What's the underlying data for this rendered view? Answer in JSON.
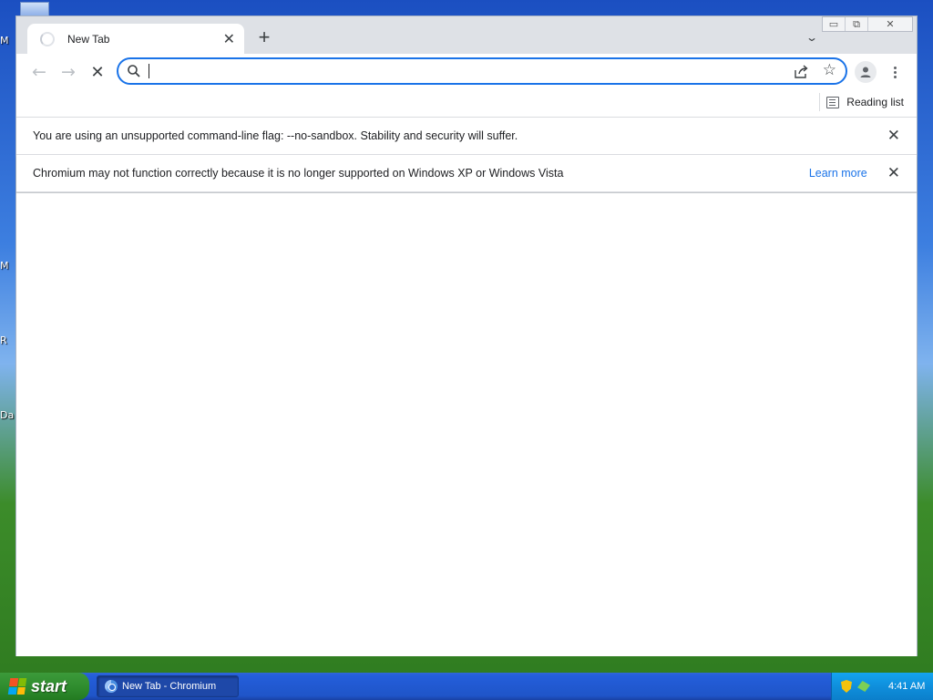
{
  "desktop": {
    "labels": [
      "M",
      "M",
      "R",
      "Da"
    ]
  },
  "window": {
    "controls": {
      "minimize": "▭",
      "restore": "⧉",
      "close": "✕"
    }
  },
  "tabs": [
    {
      "title": "New Tab",
      "close": "✕"
    }
  ],
  "tabstrip": {
    "new_tab": "+",
    "tab_search": "⌄"
  },
  "toolbar": {
    "back": "←",
    "forward": "→",
    "stop": "✕",
    "omnibox": {
      "value": "",
      "placeholder": ""
    }
  },
  "bookmarks": {
    "reading_list": "Reading list"
  },
  "infobars": [
    {
      "message": "You are using an unsupported command-line flag: --no-sandbox. Stability and security will suffer.",
      "close": "✕"
    },
    {
      "message": "Chromium may not function correctly because it is no longer supported on Windows XP or Windows Vista",
      "link": "Learn more",
      "close": "✕"
    }
  ],
  "taskbar": {
    "start": "start",
    "items": [
      {
        "label": "New Tab - Chromium"
      }
    ],
    "clock": "4:41 AM"
  },
  "colors": {
    "accent": "#1a73e8",
    "tabstrip_bg": "#dee1e6",
    "taskbar_blue": "#245edb",
    "start_green": "#2d8a2c"
  },
  "icons": [
    "search-icon",
    "share-icon",
    "star-icon",
    "profile-icon",
    "menu-icon",
    "reading-list-icon",
    "windows-logo-icon",
    "chromium-icon",
    "shield-icon",
    "network-icon"
  ]
}
